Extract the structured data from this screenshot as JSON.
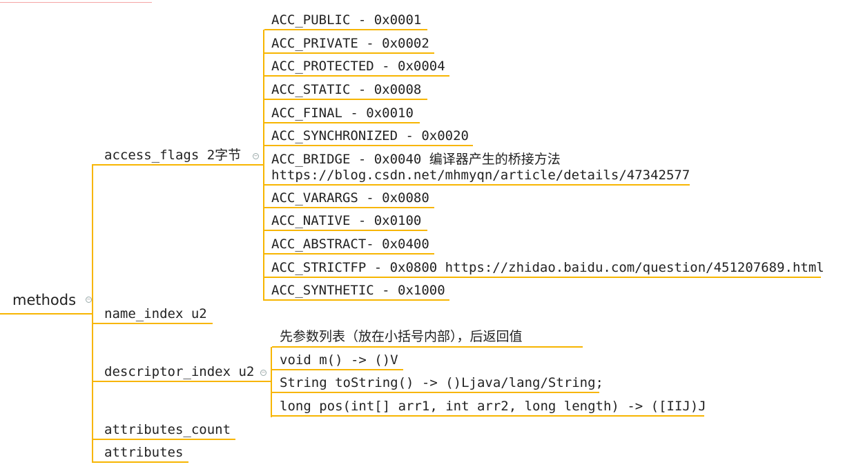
{
  "root": {
    "label": "methods"
  },
  "branches": {
    "access_flags": "access_flags 2字节",
    "name_index": "name_index u2",
    "descriptor_index": "descriptor_index u2",
    "attributes_count": "attributes_count",
    "attributes": "attributes"
  },
  "flags": [
    "ACC_PUBLIC - 0x0001",
    "ACC_PRIVATE - 0x0002",
    "ACC_PROTECTED - 0x0004",
    "ACC_STATIC - 0x0008",
    "ACC_FINAL - 0x0010",
    "ACC_SYNCHRONIZED - 0x0020",
    "ACC_BRIDGE - 0x0040 编译器产生的桥接方法",
    "https://blog.csdn.net/mhmyqn/article/details/47342577",
    "ACC_VARARGS - 0x0080",
    "ACC_NATIVE - 0x0100",
    "ACC_ABSTRACT- 0x0400",
    "ACC_STRICTFP - 0x0800 https://zhidao.baidu.com/question/451207689.html",
    "ACC_SYNTHETIC - 0x1000"
  ],
  "descriptors": [
    "先参数列表（放在小括号内部），后返回值",
    "void m() -> ()V",
    "String toString() -> ()Ljava/lang/String;",
    "long pos(int[] arr1, int arr2, long length) -> ([IIJ)J"
  ],
  "colors": {
    "connector": "#f7b500",
    "text": "#222222"
  }
}
